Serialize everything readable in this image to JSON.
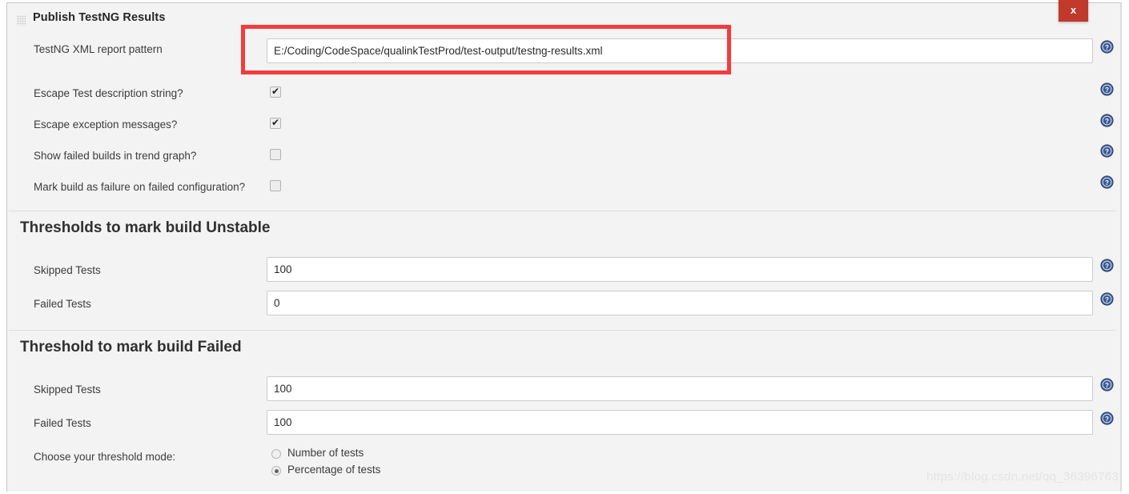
{
  "panel": {
    "title": "Publish TestNG Results",
    "grip_icon": "drag-grip-icon",
    "close_label": "x"
  },
  "report_pattern": {
    "label": "TestNG XML report pattern",
    "value": "E:/Coding/CodeSpace/qualinkTestProd/test-output/testng-results.xml",
    "placeholder": ""
  },
  "checkboxes": [
    {
      "label": "Escape Test description string?",
      "checked": true
    },
    {
      "label": "Escape exception messages?",
      "checked": true
    },
    {
      "label": "Show failed builds in trend graph?",
      "checked": false
    },
    {
      "label": "Mark build as failure on failed configuration?",
      "checked": false
    }
  ],
  "unstable_section": {
    "title": "Thresholds to mark build Unstable",
    "fields": [
      {
        "label": "Skipped Tests",
        "value": "100"
      },
      {
        "label": "Failed Tests",
        "value": "0"
      }
    ]
  },
  "failed_section": {
    "title": "Threshold to mark build Failed",
    "fields": [
      {
        "label": "Skipped Tests",
        "value": "100"
      },
      {
        "label": "Failed Tests",
        "value": "100"
      }
    ],
    "threshold_mode": {
      "label": "Choose your threshold mode:",
      "options": [
        {
          "label": "Number of tests",
          "selected": false
        },
        {
          "label": "Percentage of tests",
          "selected": true
        }
      ]
    }
  },
  "help_icon_name": "help-question-icon",
  "watermark": "https://blog.csdn.net/qq_36396763",
  "colors": {
    "highlight": "#f53b3b",
    "close_button": "#c0392b",
    "help_icon": "#3c5a96",
    "panel_bg": "#f3f3f3"
  }
}
